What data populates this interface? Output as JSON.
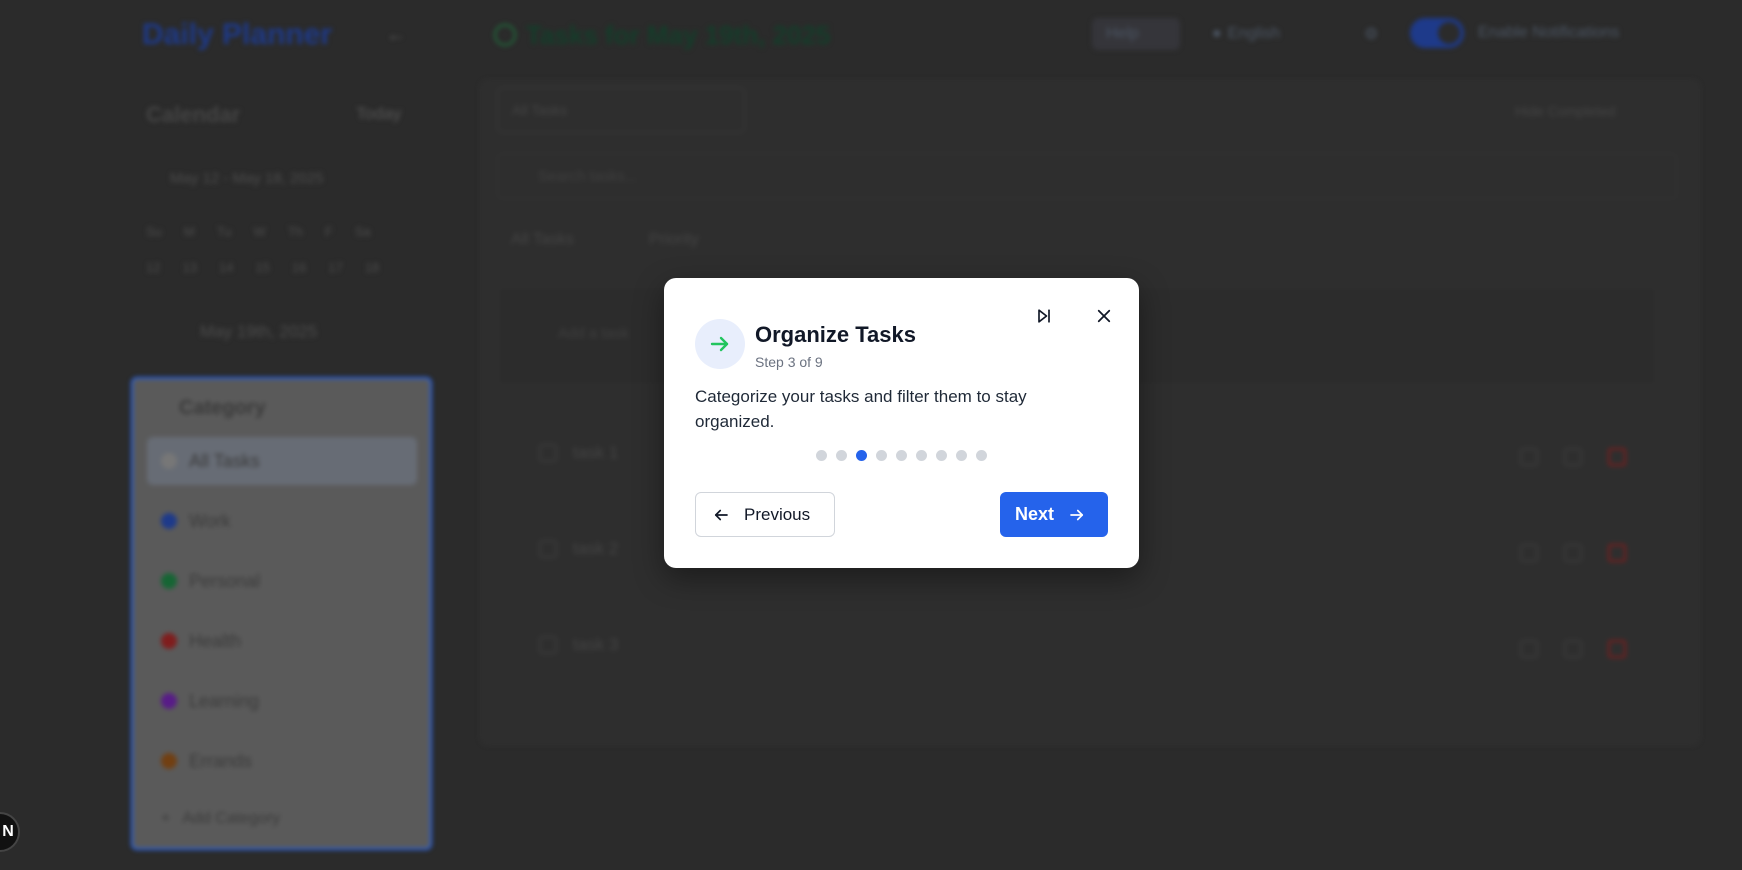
{
  "app": {
    "title": "Daily Planner",
    "header_title": "Tasks for May 19th, 2025",
    "help_label": "Help",
    "language_label": "English",
    "notifications_label": "Enable Notifications"
  },
  "calendar": {
    "title": "Calendar",
    "today_label": "Today",
    "range": "May 12 - May 18, 2025",
    "weekdays": [
      "Su",
      "M",
      "Tu",
      "W",
      "Th",
      "F",
      "Sa"
    ],
    "days": [
      "12",
      "13",
      "14",
      "15",
      "16",
      "17",
      "18"
    ],
    "selected_date": "May 19th, 2025"
  },
  "categories": {
    "title": "Category",
    "items": [
      {
        "label": "All Tasks",
        "color": "#9ca3af"
      },
      {
        "label": "Work",
        "color": "#3b82f6"
      },
      {
        "label": "Personal",
        "color": "#22c55e"
      },
      {
        "label": "Health",
        "color": "#ef4444"
      },
      {
        "label": "Learning",
        "color": "#a855f7"
      },
      {
        "label": "Errands",
        "color": "#eab308"
      }
    ],
    "add_label": "Add Category"
  },
  "main": {
    "filter_tab": "All Tasks",
    "hide_completed": "Hide Completed",
    "search_placeholder": "Search tasks...",
    "sort_all": "All Tasks",
    "sort_priority": "Priority",
    "add_placeholder": "Add a task",
    "tasks": [
      {
        "label": "task 1"
      },
      {
        "label": "task 2"
      },
      {
        "label": "task 3"
      }
    ]
  },
  "tour": {
    "title": "Organize Tasks",
    "step": "Step 3 of 9",
    "description": "Categorize your tasks and filter them to stay organized.",
    "total_steps": 9,
    "current_step": 3,
    "previous_label": "Previous",
    "next_label": "Next",
    "accent_color": "#2563eb",
    "icon_color": "#22c55e"
  },
  "corner_badge": "N"
}
